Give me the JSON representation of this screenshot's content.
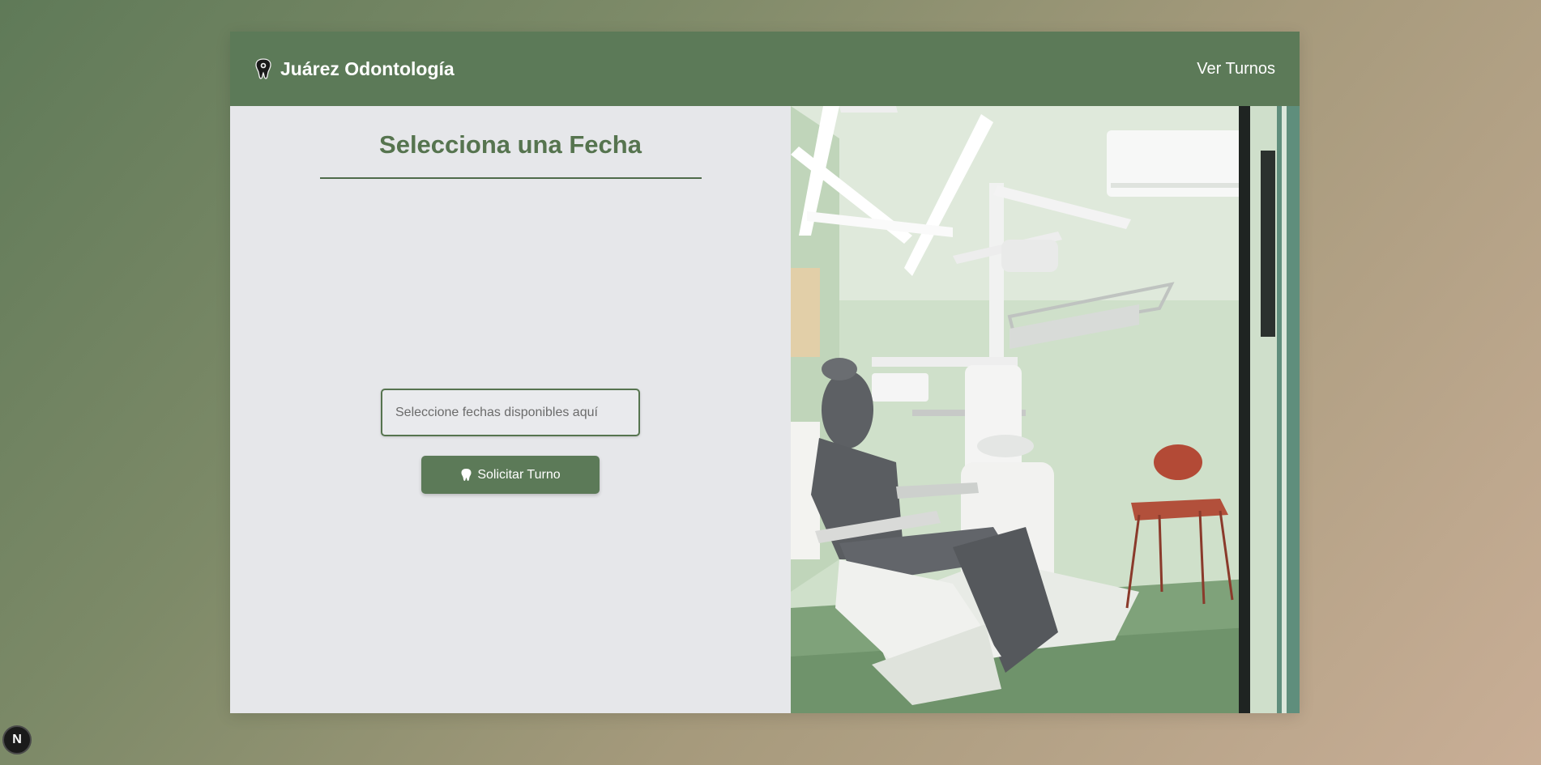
{
  "navbar": {
    "brand_name": "Juárez Odontología",
    "brand_icon": "tooth-icon",
    "turnos_link": "Ver Turnos"
  },
  "booking": {
    "title": "Selecciona una Fecha",
    "date_placeholder": "Seleccione fechas disponibles aquí",
    "date_value": "",
    "submit_label": "Solicitar Turno",
    "submit_icon": "tooth-icon"
  },
  "image": {
    "description_icon": "dental-clinic-photo"
  },
  "dev_badge": {
    "letter": "N",
    "icon": "nextjs-icon"
  },
  "colors": {
    "primary": "#5c7a58",
    "title": "#56744f",
    "panel_bg": "#e6e7ea"
  }
}
